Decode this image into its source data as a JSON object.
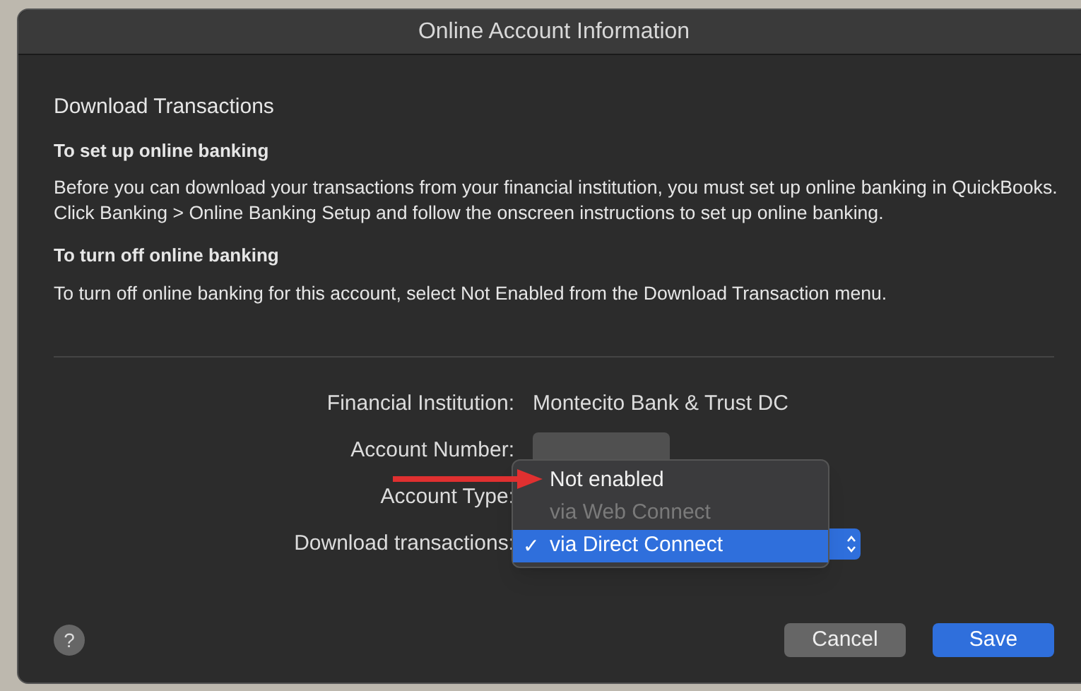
{
  "window": {
    "title": "Online Account Information"
  },
  "heading": "Download Transactions",
  "sections": [
    {
      "heading": "To set up online banking",
      "text": "Before you can download your transactions from your financial  institution, you must set up online banking in QuickBooks. Click Banking > Online Banking Setup and follow the onscreen instructions to set up online banking."
    },
    {
      "heading": "To turn off online banking",
      "text": "To turn off online banking for this account, select Not Enabled from the Download Transaction menu."
    }
  ],
  "form": [
    {
      "label": "Financial Institution:",
      "kind": "text",
      "value": "Montecito Bank & Trust DC"
    },
    {
      "label": "Account Number:",
      "kind": "blurred"
    },
    {
      "label": "Account Type:",
      "kind": "hidden"
    },
    {
      "label": "Download transactions:",
      "kind": "popup"
    }
  ],
  "menu": [
    {
      "label": "Not enabled",
      "disabled": false,
      "selected": false
    },
    {
      "label": "via Web Connect",
      "disabled": true,
      "selected": false
    },
    {
      "label": "via Direct Connect",
      "disabled": false,
      "selected": true
    }
  ],
  "check": "✓",
  "help": "?",
  "buttons": [
    {
      "label": "Cancel",
      "kind": "secondary"
    },
    {
      "label": "Save",
      "kind": "primary"
    }
  ]
}
